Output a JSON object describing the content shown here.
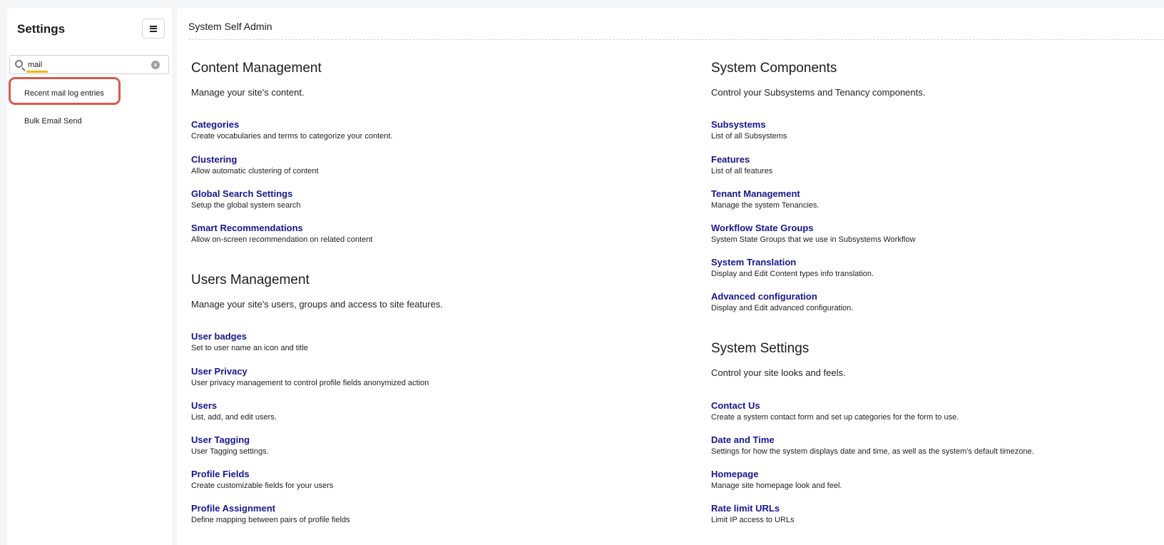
{
  "sidebar": {
    "title": "Settings",
    "search": {
      "value": "mail",
      "placeholder": ""
    },
    "items": [
      {
        "label": "Recent mail log entries"
      },
      {
        "label": "Bulk Email Send"
      }
    ]
  },
  "main": {
    "title": "System Self Admin",
    "left_sections": [
      {
        "title": "Content Management",
        "description": "Manage your site's content.",
        "items": [
          {
            "label": "Categories",
            "desc": "Create vocabularies and terms to categorize your content."
          },
          {
            "label": "Clustering",
            "desc": "Allow automatic clustering of content"
          },
          {
            "label": "Global Search Settings",
            "desc": "Setup the global system search"
          },
          {
            "label": "Smart Recommendations",
            "desc": "Allow on-screen recommendation on related content"
          }
        ]
      },
      {
        "title": "Users Management",
        "description": "Manage your site's users, groups and access to site features.",
        "items": [
          {
            "label": "User badges",
            "desc": "Set to user name an icon and title"
          },
          {
            "label": "User Privacy",
            "desc": "User privacy management to control profile fields anonymized action"
          },
          {
            "label": "Users",
            "desc": "List, add, and edit users."
          },
          {
            "label": "User Tagging",
            "desc": "User Tagging settings."
          },
          {
            "label": "Profile Fields",
            "desc": "Create customizable fields for your users"
          },
          {
            "label": "Profile Assignment",
            "desc": "Define mapping between pairs of profile fields"
          }
        ]
      }
    ],
    "right_sections": [
      {
        "title": "System Components",
        "description": "Control your Subsystems and Tenancy components.",
        "items": [
          {
            "label": "Subsystems",
            "desc": "List of all Subsystems"
          },
          {
            "label": "Features",
            "desc": "List of all features"
          },
          {
            "label": "Tenant Management",
            "desc": "Manage the system Tenancies."
          },
          {
            "label": "Workflow State Groups",
            "desc": "System State Groups that we use in Subsystems Workflow"
          },
          {
            "label": "System Translation",
            "desc": "Display and Edit Content types info translation."
          },
          {
            "label": "Advanced configuration",
            "desc": "Display and Edit advanced configuration."
          }
        ]
      },
      {
        "title": "System Settings",
        "description": "Control your site looks and feels.",
        "items": [
          {
            "label": "Contact Us",
            "desc": "Create a system contact form and set up categories for the form to use."
          },
          {
            "label": "Date and Time",
            "desc": "Settings for how the system displays date and time, as well as the system's default timezone."
          },
          {
            "label": "Homepage",
            "desc": "Manage site homepage look and feel."
          },
          {
            "label": "Rate limit URLs",
            "desc": "Limit IP access to URLs"
          }
        ]
      }
    ]
  }
}
